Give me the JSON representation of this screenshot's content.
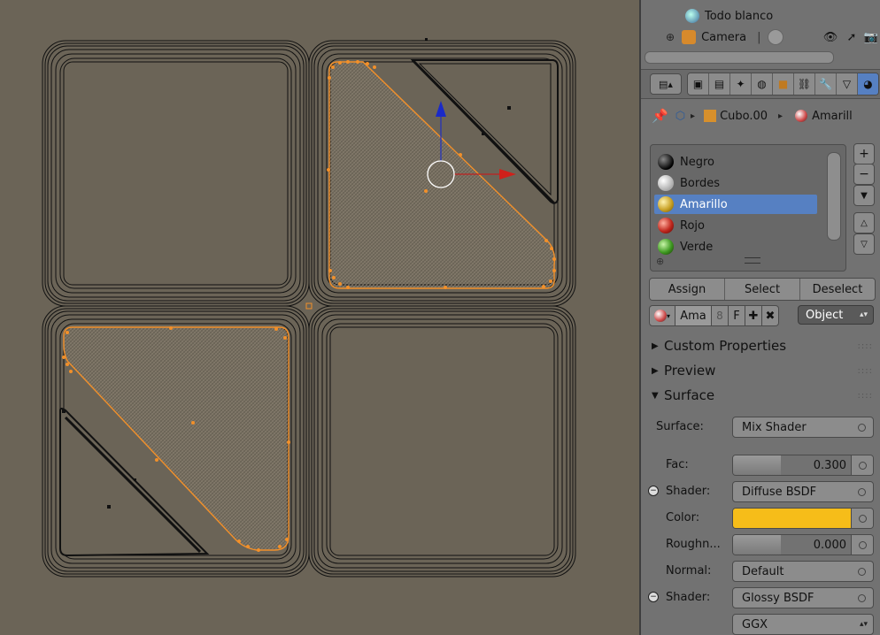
{
  "outliner": {
    "items": [
      {
        "label": "Todo blanco",
        "icon": "world-icon"
      },
      {
        "label": "Camera",
        "icon": "camera-icon"
      }
    ]
  },
  "properties": {
    "tabs": [
      "render-icon",
      "render-layers-icon",
      "scene-icon",
      "world-icon",
      "object-icon",
      "constraints-icon",
      "modifiers-icon",
      "data-icon",
      "material-icon"
    ],
    "active_tab": "material-icon",
    "breadcrumb": {
      "object": "Cubo.00",
      "material": "Amarill"
    },
    "materials": [
      {
        "name": "Negro",
        "color": "#1a1a1a"
      },
      {
        "name": "Bordes",
        "color": "#c8c8c8"
      },
      {
        "name": "Amarillo",
        "color": "#c9a227"
      },
      {
        "name": "Rojo",
        "color": "#c0281e"
      },
      {
        "name": "Verde",
        "color": "#3f9a22"
      }
    ],
    "selected_material": "Amarillo",
    "buttons": {
      "assign": "Assign",
      "select": "Select",
      "deselect": "Deselect"
    },
    "slot": {
      "name": "Ama",
      "users": "8",
      "fake": "F",
      "add": "✚",
      "remove": "✖",
      "link": "Object"
    },
    "sections": {
      "custom": "Custom Properties",
      "preview": "Preview",
      "surface": "Surface"
    },
    "surface": {
      "surface_label": "Surface:",
      "surface_value": "Mix Shader",
      "fac_label": "Fac:",
      "fac_value": "0.300",
      "fac_fraction": 0.3,
      "shader1_label": "Shader:",
      "shader1_value": "Diffuse BSDF",
      "color_label": "Color:",
      "color_value": "#f6bd19",
      "rough_label": "Roughn...",
      "rough_value": "0.000",
      "rough_fraction": 0.0,
      "normal_label": "Normal:",
      "normal_value": "Default",
      "shader2_label": "Shader:",
      "shader2_value": "Glossy BSDF",
      "distribution_value": "GGX"
    }
  },
  "viewport": {
    "background": "#6b6457",
    "selection_color": "#f2902a"
  }
}
